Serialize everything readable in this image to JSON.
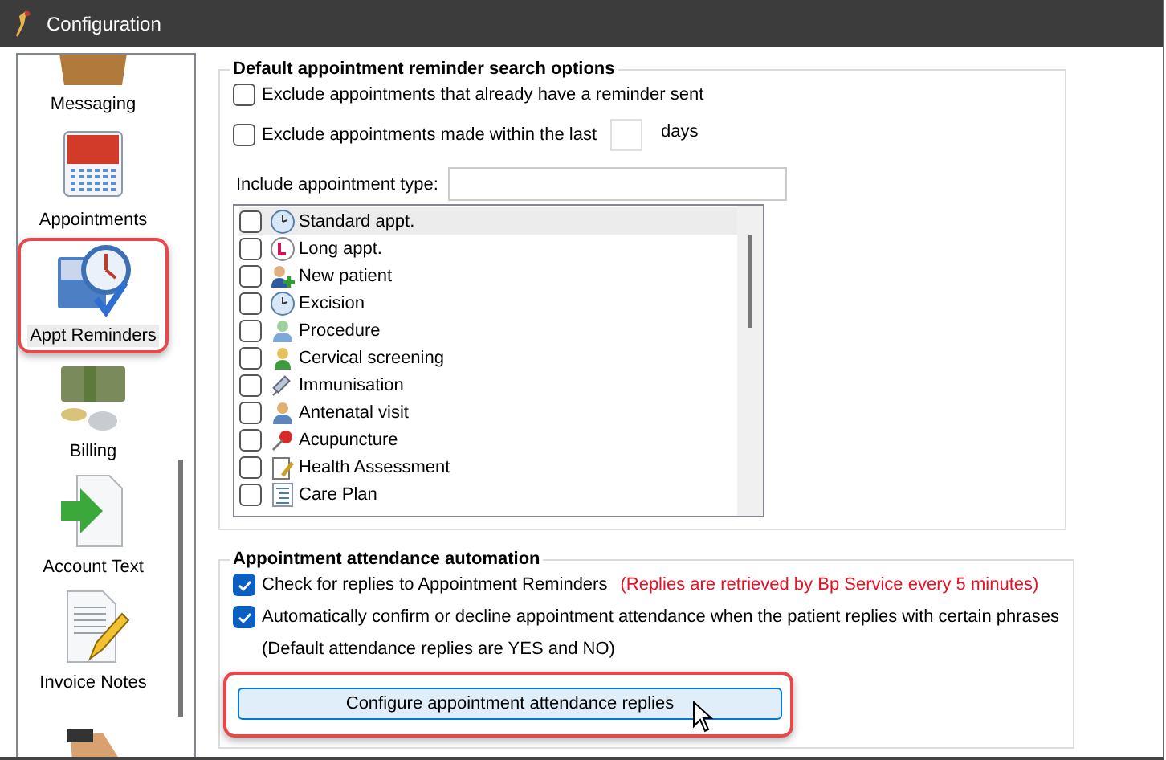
{
  "window": {
    "title": "Configuration"
  },
  "sidebar": {
    "items": [
      {
        "kind": "tray",
        "label": "Messaging",
        "selected": false,
        "callout": false
      },
      {
        "kind": "calendar",
        "label": "Appointments",
        "selected": false,
        "callout": false
      },
      {
        "kind": "calendar-clock",
        "label": "Appt Reminders",
        "selected": true,
        "callout": true
      },
      {
        "kind": "money",
        "label": "Billing",
        "selected": false,
        "callout": false
      },
      {
        "kind": "document-arrow",
        "label": "Account Text",
        "selected": false,
        "callout": false
      },
      {
        "kind": "document-pencil",
        "label": "Invoice Notes",
        "selected": false,
        "callout": false
      },
      {
        "kind": "hand",
        "selected": false,
        "callout": false
      }
    ]
  },
  "search_options": {
    "title": "Default appointment reminder search options",
    "exclude_sent": {
      "label": "Exclude appointments that already have a reminder sent",
      "checked": false
    },
    "exclude_recent": {
      "label": "Exclude appointments made within the last",
      "checked": false,
      "unit": "days"
    },
    "type_label": "Include appointment type:",
    "types": [
      {
        "kind": "clock",
        "label": "Standard appt.",
        "checked": false,
        "selected": true
      },
      {
        "kind": "clock-long",
        "label": "Long appt.",
        "checked": false,
        "selected": false
      },
      {
        "kind": "person-plus",
        "label": "New patient",
        "checked": false,
        "selected": false
      },
      {
        "kind": "clock",
        "label": "Excision",
        "checked": false,
        "selected": false
      },
      {
        "kind": "doctor",
        "label": "Procedure",
        "checked": false,
        "selected": false
      },
      {
        "kind": "woman",
        "label": "Cervical screening",
        "checked": false,
        "selected": false
      },
      {
        "kind": "syringe",
        "label": "Immunisation",
        "checked": false,
        "selected": false
      },
      {
        "kind": "person",
        "label": "Antenatal visit",
        "checked": false,
        "selected": false
      },
      {
        "kind": "pin",
        "label": "Acupuncture",
        "checked": false,
        "selected": false
      },
      {
        "kind": "clipboard",
        "label": "Health Assessment",
        "checked": false,
        "selected": false
      },
      {
        "kind": "list",
        "label": "Care Plan",
        "checked": false,
        "selected": false
      }
    ]
  },
  "automation": {
    "title": "Appointment attendance automation",
    "check_replies": {
      "label": "Check for replies to Appointment Reminders",
      "note": "(Replies are retrieved by Bp Service every 5 minutes)",
      "checked": true
    },
    "auto_confirm": {
      "label": "Automatically confirm or decline appointment attendance when the patient replies with certain phrases",
      "checked": true
    },
    "hint": "(Default attendance replies are YES and NO)",
    "button": {
      "label": "Configure appointment attendance replies",
      "callout": true
    }
  }
}
